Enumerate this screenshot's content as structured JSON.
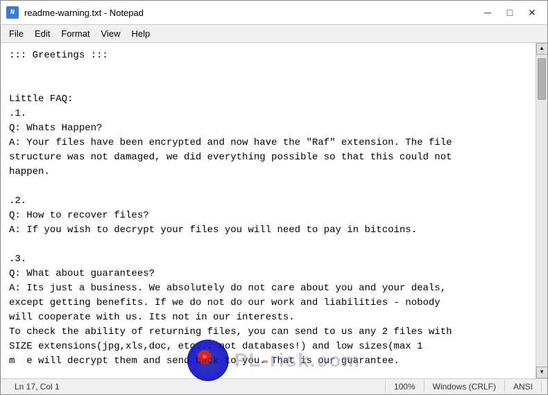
{
  "window": {
    "title": "readme-warning.txt - Notepad",
    "app_icon_text": "N"
  },
  "title_controls": {
    "minimize": "─",
    "maximize": "□",
    "close": "✕"
  },
  "menu": {
    "items": [
      "File",
      "Edit",
      "Format",
      "View",
      "Help"
    ]
  },
  "text": "::: Greetings :::\n\n\nLittle FAQ:\n.1.\nQ: Whats Happen?\nA: Your files have been encrypted and now have the \"Raf\" extension. The file\nstructure was not damaged, we did everything possible so that this could not\nhappen.\n\n.2.\nQ: How to recover files?\nA: If you wish to decrypt your files you will need to pay in bitcoins.\n\n.3.\nQ: What about guarantees?\nA: Its just a business. We absolutely do not care about you and your deals,\nexcept getting benefits. If we do not do our work and liabilities - nobody\nwill cooperate with us. Its not in our interests.\nTo check the ability of returning files, you can send to us any 2 files with\nSIZE extensions(jpg,xls,doc, etc... not databases!) and low sizes(max 1\nm  e will decrypt them and send back to you. That is our guarantee.",
  "status_bar": {
    "position": "Ln 17, Col 1",
    "zoom": "100%",
    "line_ending": "Windows (CRLF)",
    "encoding": "ANSI"
  },
  "watermark": {
    "text_before": "PL",
    "text_accent": "-",
    "text_after": "risk",
    "domain": ".com"
  }
}
